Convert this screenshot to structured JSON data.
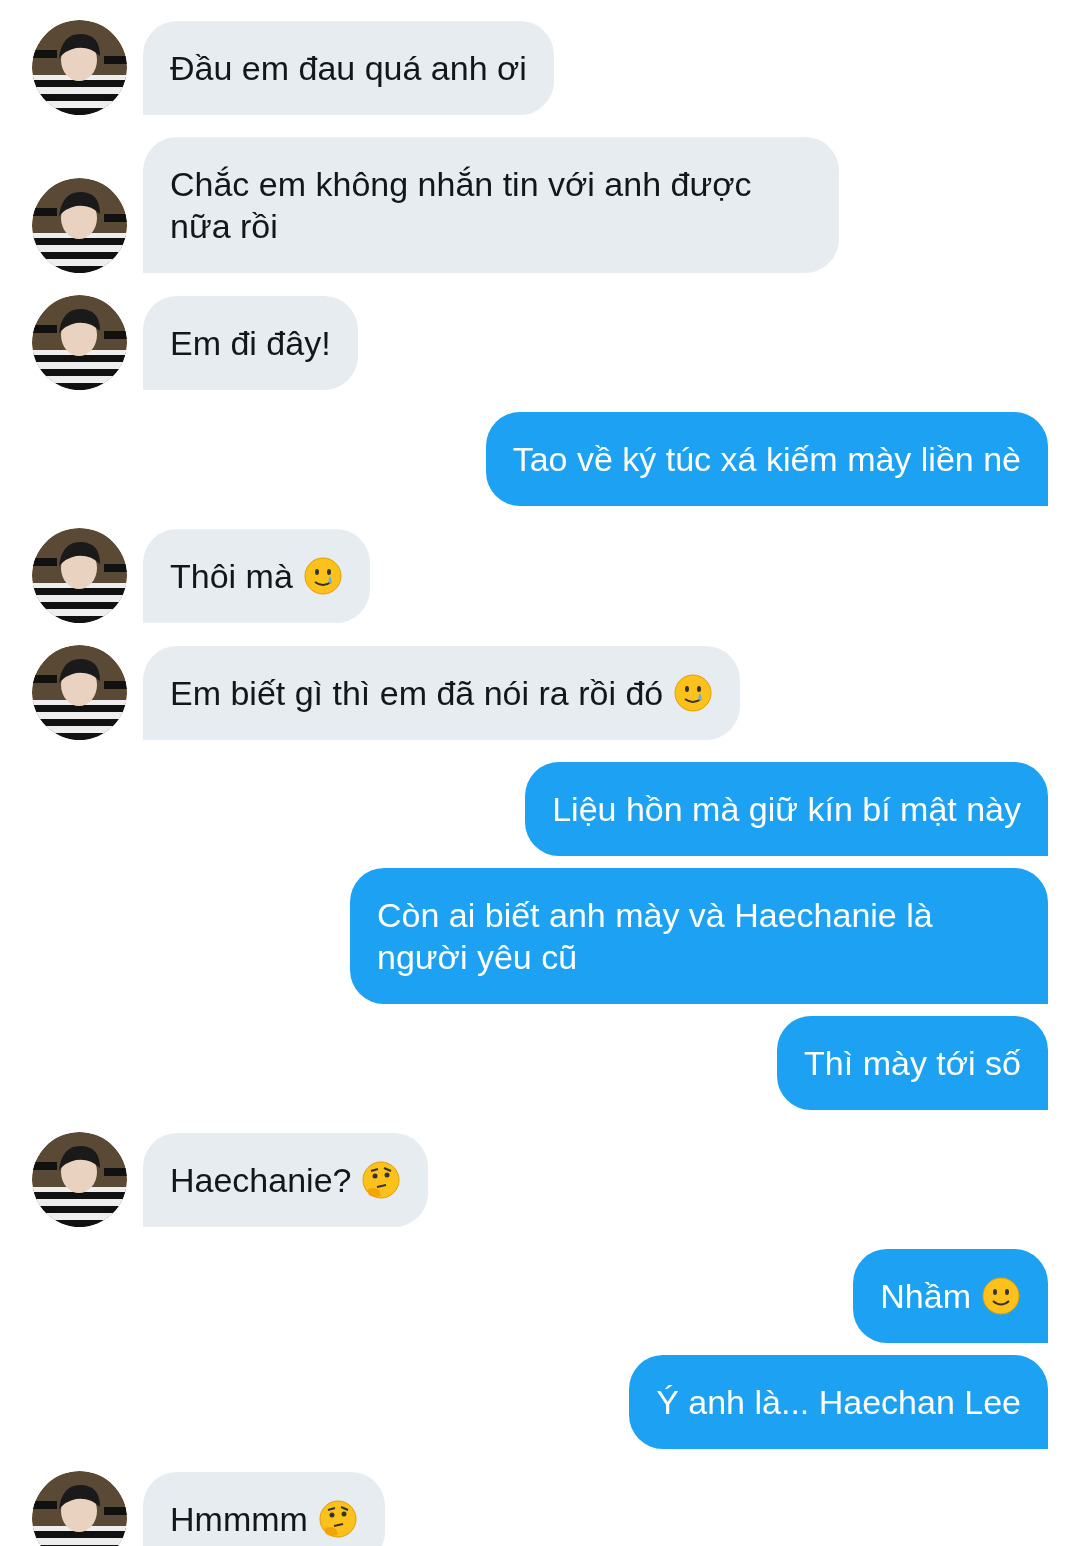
{
  "messages": [
    {
      "kind": "incoming",
      "text": "Đầu em đau quá anh ơi"
    },
    {
      "kind": "incoming",
      "text": "Chắc em không nhắn tin với anh được nữa rồi"
    },
    {
      "kind": "incoming",
      "text": "Em đi đây!"
    },
    {
      "kind": "outgoing",
      "text": "Tao về ký túc xá kiếm mày liền nè"
    },
    {
      "kind": "incoming",
      "text": "Thôi mà",
      "emoji": {
        "kind": "tear"
      }
    },
    {
      "kind": "incoming",
      "text": "Em biết gì thì em đã nói ra rồi đó",
      "emoji": {
        "kind": "tear"
      }
    },
    {
      "kind": "outgoing",
      "text": "Liệu hồn mà giữ kín bí mật này"
    },
    {
      "kind": "outgoing",
      "text": "Còn ai biết anh mày và Haechanie là người yêu cũ"
    },
    {
      "kind": "outgoing",
      "text": "Thì mày tới số"
    },
    {
      "kind": "incoming",
      "text": "Haechanie?",
      "emoji": {
        "kind": "thinking"
      }
    },
    {
      "kind": "outgoing",
      "text": "Nhầm",
      "emoji": {
        "kind": "smile"
      }
    },
    {
      "kind": "outgoing",
      "text": "Ý anh là... Haechan Lee"
    },
    {
      "kind": "incoming",
      "text": "Hmmmm",
      "emoji": {
        "kind": "thinking"
      }
    }
  ]
}
